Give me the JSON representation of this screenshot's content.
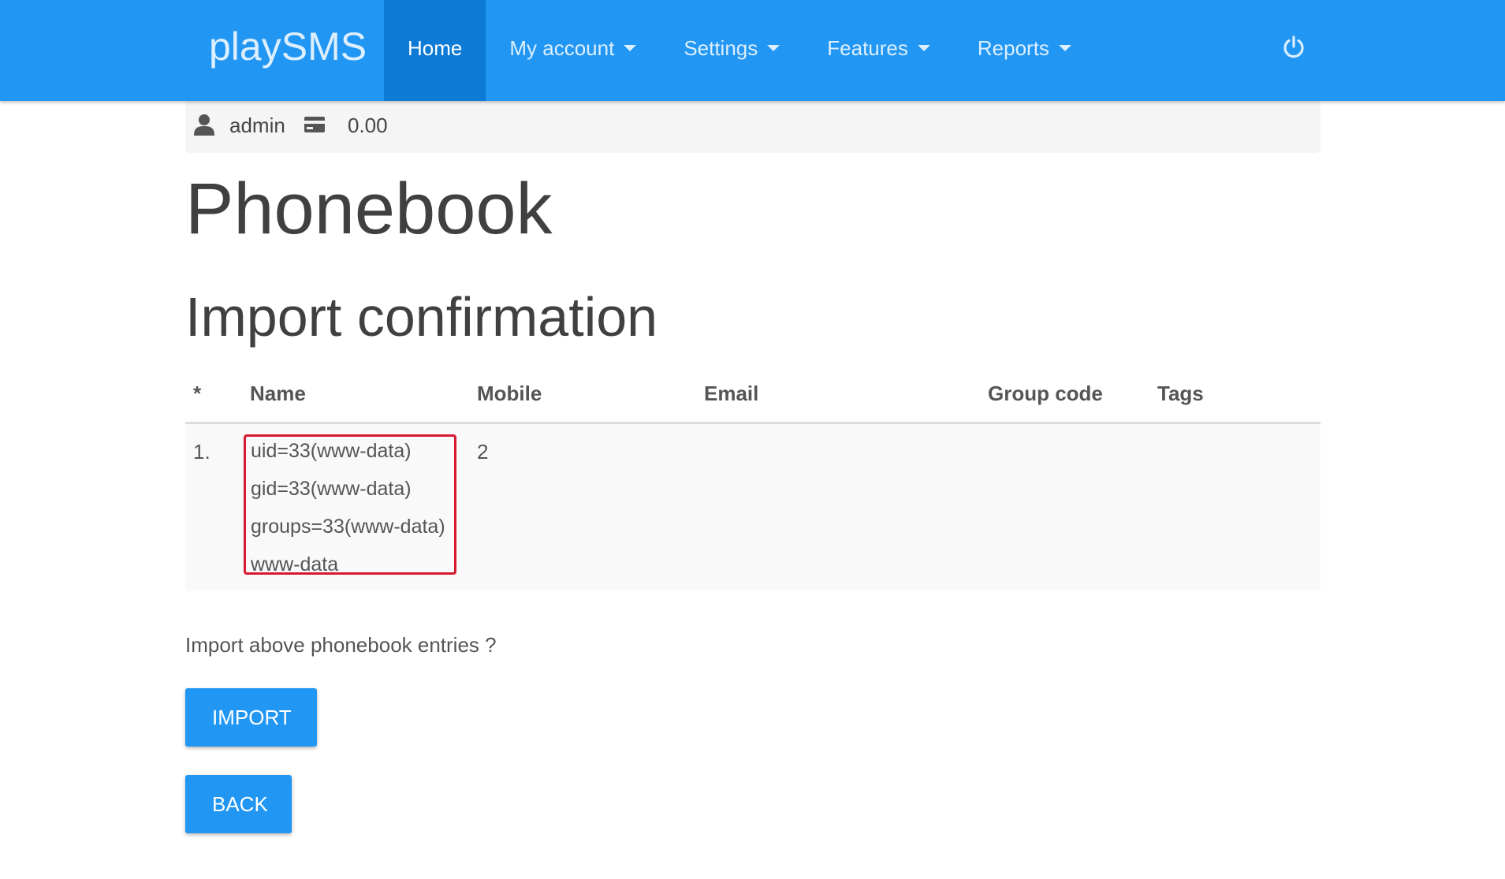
{
  "app": {
    "brand": "playSMS"
  },
  "nav": {
    "items": [
      {
        "label": "Home",
        "active": true,
        "dropdown": false
      },
      {
        "label": "My account",
        "active": false,
        "dropdown": true
      },
      {
        "label": "Settings",
        "active": false,
        "dropdown": true
      },
      {
        "label": "Features",
        "active": false,
        "dropdown": true
      },
      {
        "label": "Reports",
        "active": false,
        "dropdown": true
      }
    ],
    "logout_icon": "power-icon"
  },
  "userbar": {
    "user_icon": "user-icon",
    "username": "admin",
    "credit_icon": "credit-card-icon",
    "credit": "0.00"
  },
  "page": {
    "title": "Phonebook",
    "subtitle": "Import confirmation"
  },
  "table": {
    "headers": [
      "*",
      "Name",
      "Mobile",
      "Email",
      "Group code",
      "Tags"
    ],
    "rows": [
      {
        "index": "1.",
        "name_lines": [
          "uid=33(www-data)",
          "gid=33(www-data)",
          "groups=33(www-data)",
          "www-data"
        ],
        "mobile": "2",
        "email": "",
        "group_code": "",
        "tags": ""
      }
    ]
  },
  "confirm": {
    "prompt": "Import above phonebook entries ?",
    "import_label": "IMPORT",
    "back_label": "BACK"
  },
  "colors": {
    "navbar": "#2196f3",
    "nav_active": "#0d7ad6",
    "highlight_border": "#d9192f",
    "button": "#2196f3"
  }
}
